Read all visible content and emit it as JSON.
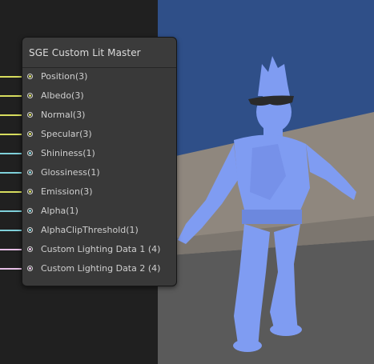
{
  "node": {
    "title": "SGE Custom Lit Master",
    "ports": [
      {
        "label": "Position(3)",
        "wire_color": "#d7dd5e"
      },
      {
        "label": "Albedo(3)",
        "wire_color": "#d7dd5e"
      },
      {
        "label": "Normal(3)",
        "wire_color": "#d7dd5e"
      },
      {
        "label": "Specular(3)",
        "wire_color": "#d7dd5e"
      },
      {
        "label": "Shininess(1)",
        "wire_color": "#7fd0da"
      },
      {
        "label": "Glossiness(1)",
        "wire_color": "#7fd0da"
      },
      {
        "label": "Emission(3)",
        "wire_color": "#d7dd5e"
      },
      {
        "label": "Alpha(1)",
        "wire_color": "#7fd0da"
      },
      {
        "label": "AlphaClipThreshold(1)",
        "wire_color": "#7fd0da"
      },
      {
        "label": "Custom Lighting Data 1 (4)",
        "wire_color": "#e7bfe6"
      },
      {
        "label": "Custom Lighting Data 2 (4)",
        "wire_color": "#e7bfe6"
      }
    ]
  },
  "viewport": {
    "sky_color": "#2f4f88",
    "ground_color": "#8f877e",
    "floor_color": "#5a5a5a",
    "character_color": "#7f9cf2"
  }
}
